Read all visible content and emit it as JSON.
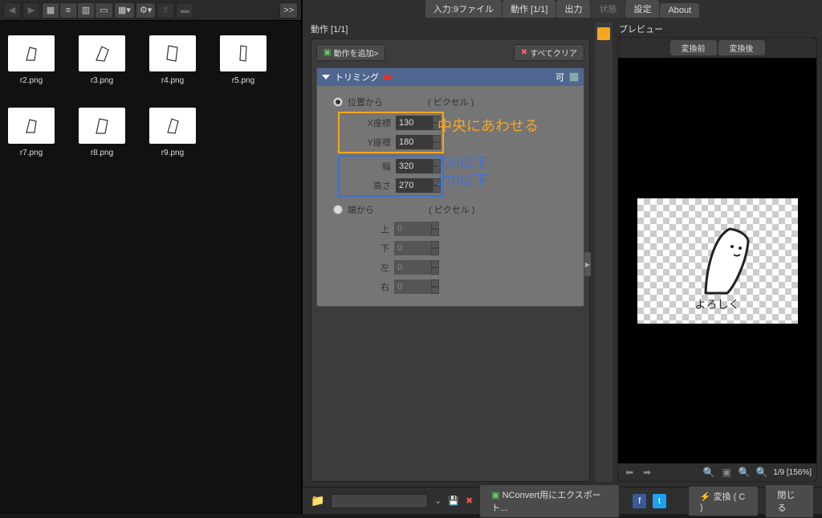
{
  "left_toolbar": {
    "expand": ">>"
  },
  "thumbnails": [
    {
      "label": "r2.png"
    },
    {
      "label": "r3.png"
    },
    {
      "label": "r4.png"
    },
    {
      "label": "r5.png"
    },
    {
      "label": "r7.png"
    },
    {
      "label": "r8.png"
    },
    {
      "label": "r9.png"
    }
  ],
  "tabs": {
    "input": "入力:9ファイル",
    "action": "動作 [1/1]",
    "output": "出力",
    "state": "状態",
    "settings": "設定",
    "about": "About"
  },
  "actions": {
    "header": "動作 [1/1]",
    "add": "動作を追加>",
    "clear": "すべてクリア",
    "item_title": "トリミング",
    "item_flag": "可",
    "from_pos": "位置から",
    "unit": "( ピクセル )",
    "fields": {
      "x": {
        "label": "X座標",
        "value": "130"
      },
      "y": {
        "label": "Y座標",
        "value": "180"
      },
      "w": {
        "label": "幅",
        "value": "320"
      },
      "h": {
        "label": "高さ",
        "value": "270"
      }
    },
    "from_edge": "端から",
    "edges": {
      "top": {
        "label": "上",
        "value": "0"
      },
      "bottom": {
        "label": "下",
        "value": "0"
      },
      "left": {
        "label": "左",
        "value": "0"
      },
      "right": {
        "label": "右",
        "value": "0"
      }
    },
    "annot_center": "中央にあわせる",
    "annot_w": "320以下",
    "annot_h": "270以下"
  },
  "preview": {
    "header": "プレビュー",
    "before": "変換前",
    "after": "変換後",
    "caption": "よろしく",
    "info": "1/9 [156%]"
  },
  "footer": {
    "export": "NConvert用にエクスポート...",
    "convert": "変換 ( C )",
    "close": "閉じる"
  }
}
